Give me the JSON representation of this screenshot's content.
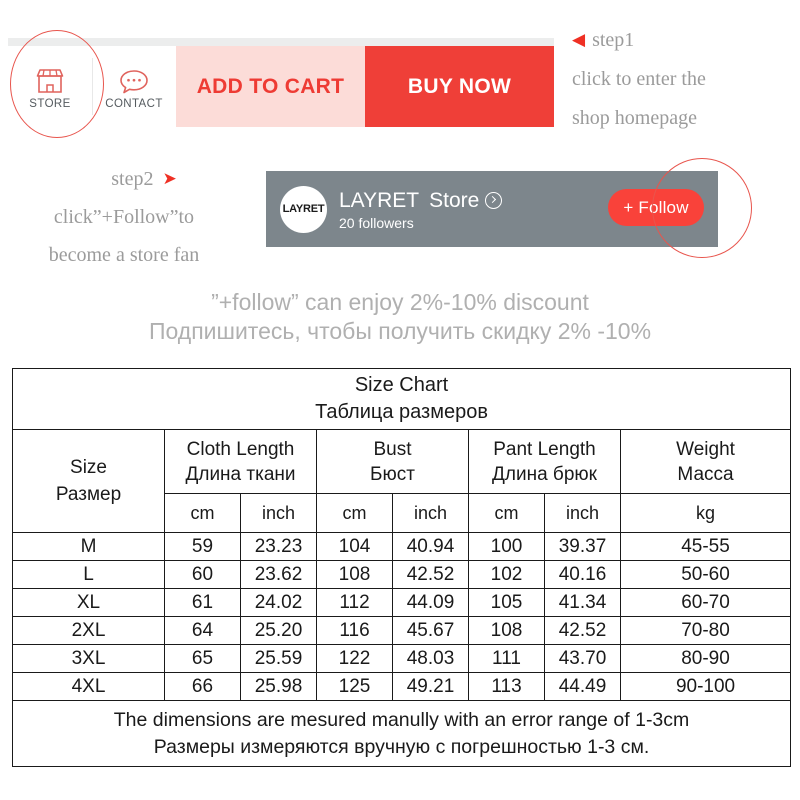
{
  "action_bar": {
    "store": {
      "label": "STORE",
      "icon": "shop-icon"
    },
    "contact": {
      "label": "CONTACT",
      "icon": "speech-bubble-icon"
    },
    "add_to_cart_label": "ADD TO CART",
    "buy_now_label": "BUY NOW",
    "colors": {
      "add_to_cart_bg": "#fcdcd8",
      "add_to_cart_text": "#ee3b34",
      "buy_now_bg": "#ef3f38",
      "buy_now_text": "#ffffff",
      "icon_red": "#e0635d",
      "highlight_red": "#e8554d"
    }
  },
  "annotations": {
    "step1": {
      "arrow": "◀",
      "line1": "step1",
      "line2": "click to enter the",
      "line3": "shop homepage"
    },
    "step2": {
      "arrow": "➤",
      "line1": "step2",
      "line2": "click”+Follow”to",
      "line3": "become a store fan"
    }
  },
  "store_banner": {
    "avatar_text": "LAYRET",
    "name": "LAYRET",
    "name_suffix": "Store",
    "chevron_icon": "chevron-right-circle-icon",
    "followers": "20 followers",
    "follow_button_label": "+ Follow",
    "banner_bg": "#7d868c",
    "follow_bg": "#f9423a"
  },
  "discount": {
    "line_en": "”+follow”   can enjoy 2%-10% discount",
    "line_ru": "Подпишитесь, чтобы получить скидку 2% -10%"
  },
  "size_chart": {
    "title_en": "Size Chart",
    "title_ru": "Таблица размеров",
    "headers": {
      "size_en": "Size",
      "size_ru": "Размер",
      "cloth_en": "Cloth Length",
      "cloth_ru": "Длина ткани",
      "bust_en": "Bust",
      "bust_ru": "Бюст",
      "pant_en": "Pant Length",
      "pant_ru": "Длина брюк",
      "weight_en": "Weight",
      "weight_ru": "Масса"
    },
    "units": {
      "cloth_cm": "cm",
      "cloth_inch": "inch",
      "bust_cm": "cm",
      "bust_inch": "inch",
      "pant_cm": "cm",
      "pant_inch": "inch",
      "weight_kg": "kg"
    },
    "rows": [
      {
        "size": "M",
        "cloth_cm": "59",
        "cloth_inch": "23.23",
        "bust_cm": "104",
        "bust_inch": "40.94",
        "pant_cm": "100",
        "pant_inch": "39.37",
        "weight_kg": "45-55"
      },
      {
        "size": "L",
        "cloth_cm": "60",
        "cloth_inch": "23.62",
        "bust_cm": "108",
        "bust_inch": "42.52",
        "pant_cm": "102",
        "pant_inch": "40.16",
        "weight_kg": "50-60"
      },
      {
        "size": "XL",
        "cloth_cm": "61",
        "cloth_inch": "24.02",
        "bust_cm": "112",
        "bust_inch": "44.09",
        "pant_cm": "105",
        "pant_inch": "41.34",
        "weight_kg": "60-70"
      },
      {
        "size": "2XL",
        "cloth_cm": "64",
        "cloth_inch": "25.20",
        "bust_cm": "116",
        "bust_inch": "45.67",
        "pant_cm": "108",
        "pant_inch": "42.52",
        "weight_kg": "70-80"
      },
      {
        "size": "3XL",
        "cloth_cm": "65",
        "cloth_inch": "25.59",
        "bust_cm": "122",
        "bust_inch": "48.03",
        "pant_cm": "111",
        "pant_inch": "43.70",
        "weight_kg": "80-90"
      },
      {
        "size": "4XL",
        "cloth_cm": "66",
        "cloth_inch": "25.98",
        "bust_cm": "125",
        "bust_inch": "49.21",
        "pant_cm": "113",
        "pant_inch": "44.49",
        "weight_kg": "90-100"
      }
    ],
    "note_en": "The dimensions are mesured manully with an error range of 1-3cm",
    "note_ru": "Размеры измеряются вручную с погрешностью 1-3 см."
  }
}
